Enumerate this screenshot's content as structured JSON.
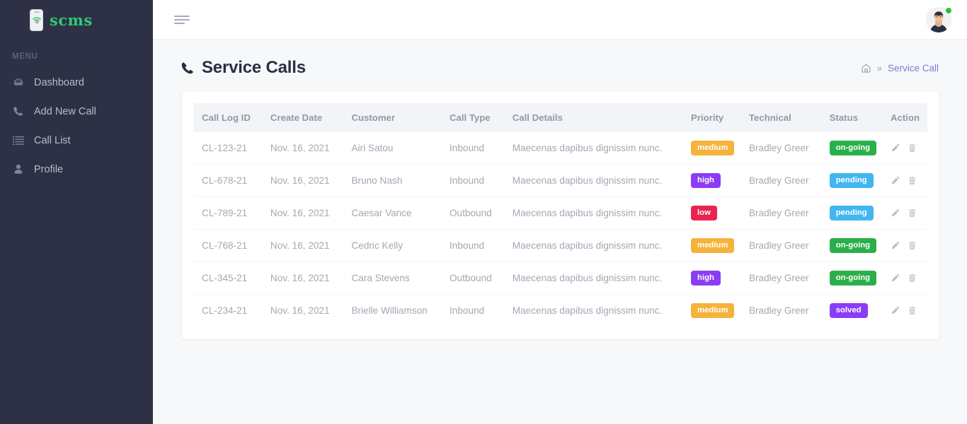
{
  "brand": {
    "name": "scms",
    "logo_icon": "phone-wifi-gear-icon",
    "color": "#2ecb71"
  },
  "sidebar": {
    "menu_label": "MENU",
    "background": "#2e3146",
    "items": [
      {
        "label": "Dashboard",
        "icon": "dashboard-gauge-icon"
      },
      {
        "label": "Add New Call",
        "icon": "phone-icon"
      },
      {
        "label": "Call List",
        "icon": "list-icon"
      },
      {
        "label": "Profile",
        "icon": "user-icon"
      }
    ]
  },
  "topbar": {
    "menu_toggle_icon": "hamburger-icon",
    "avatar_icon": "user-avatar",
    "status": "online",
    "status_color": "#22c32e"
  },
  "page": {
    "title": "Service Calls",
    "title_icon": "phone-icon",
    "breadcrumb": {
      "home_icon": "home-icon",
      "separator": "»",
      "current": "Service Call",
      "link_color": "#7a7fd0"
    }
  },
  "table": {
    "columns": [
      "Call Log ID",
      "Create Date",
      "Customer",
      "Call Type",
      "Call Details",
      "Priority",
      "Technical",
      "Status",
      "Action"
    ],
    "action_icons": [
      "pencil-icon",
      "trash-icon"
    ],
    "badge_colors": {
      "medium": "#f5b33c",
      "high": "#8b3cf5",
      "low": "#e8244f",
      "on-going": "#2ab04a",
      "pending": "#41b6f0",
      "solved": "#8b3cf5"
    },
    "rows": [
      {
        "call_log_id": "CL-123-21",
        "create_date": "Nov. 16, 2021",
        "customer": "Airi Satou",
        "call_type": "Inbound",
        "call_details": "Maecenas dapibus dignissim nunc.",
        "priority": "medium",
        "technical": "Bradley Greer",
        "status": "on-going"
      },
      {
        "call_log_id": "CL-678-21",
        "create_date": "Nov. 16, 2021",
        "customer": "Bruno Nash",
        "call_type": "Inbound",
        "call_details": "Maecenas dapibus dignissim nunc.",
        "priority": "high",
        "technical": "Bradley Greer",
        "status": "pending"
      },
      {
        "call_log_id": "CL-789-21",
        "create_date": "Nov. 16, 2021",
        "customer": "Caesar Vance",
        "call_type": "Outbound",
        "call_details": "Maecenas dapibus dignissim nunc.",
        "priority": "low",
        "technical": "Bradley Greer",
        "status": "pending"
      },
      {
        "call_log_id": "CL-768-21",
        "create_date": "Nov. 16, 2021",
        "customer": "Cedric Kelly",
        "call_type": "Inbound",
        "call_details": "Maecenas dapibus dignissim nunc.",
        "priority": "medium",
        "technical": "Bradley Greer",
        "status": "on-going"
      },
      {
        "call_log_id": "CL-345-21",
        "create_date": "Nov. 16, 2021",
        "customer": "Cara Stevens",
        "call_type": "Outbound",
        "call_details": "Maecenas dapibus dignissim nunc.",
        "priority": "high",
        "technical": "Bradley Greer",
        "status": "on-going"
      },
      {
        "call_log_id": "CL-234-21",
        "create_date": "Nov. 16, 2021",
        "customer": "Brielle Williamson",
        "call_type": "Inbound",
        "call_details": "Maecenas dapibus dignissim nunc.",
        "priority": "medium",
        "technical": "Bradley Greer",
        "status": "solved"
      }
    ]
  }
}
